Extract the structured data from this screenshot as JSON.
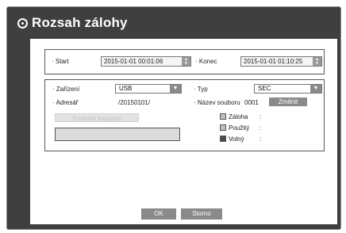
{
  "dialog": {
    "title": "Rozsah zálohy"
  },
  "range": {
    "start_label": "· Start",
    "start_value": "2015-01-01 00:01:06",
    "end_label": "· Konec",
    "end_value": "2015-01-01 01:10:25"
  },
  "device": {
    "device_label": "· Zařízení",
    "device_value": "USB",
    "type_label": "· Typ",
    "type_value": "SEC",
    "folder_label": "· Adresář",
    "folder_value": "/20150101/",
    "filename_label": "· Název souboru",
    "filename_value": "0001",
    "change_button": "Změnit",
    "check_capacity_button": "Kontrola kapacity"
  },
  "legend": {
    "backup_label": "Záloha",
    "backup_value": ":",
    "used_label": "Použitý",
    "used_value": ":",
    "free_label": "Volný",
    "free_value": ":"
  },
  "colors": {
    "backup": "#bfbfbf",
    "used": "#bfbfbf",
    "free": "#4a4a4a"
  },
  "footer": {
    "ok_label": "OK",
    "cancel_label": "Storno"
  }
}
